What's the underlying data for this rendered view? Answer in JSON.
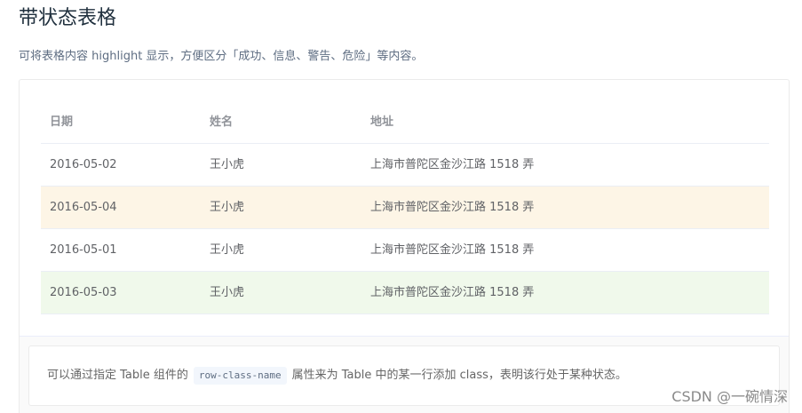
{
  "page": {
    "title": "带状态表格",
    "description": "可将表格内容 highlight 显示，方便区分「成功、信息、警告、危险」等内容。"
  },
  "table": {
    "headers": [
      "日期",
      "姓名",
      "地址"
    ],
    "rows": [
      {
        "date": "2016-05-02",
        "name": "王小虎",
        "address": "上海市普陀区金沙江路 1518 弄",
        "status": "normal"
      },
      {
        "date": "2016-05-04",
        "name": "王小虎",
        "address": "上海市普陀区金沙江路 1518 弄",
        "status": "warning"
      },
      {
        "date": "2016-05-01",
        "name": "王小虎",
        "address": "上海市普陀区金沙江路 1518 弄",
        "status": "normal"
      },
      {
        "date": "2016-05-03",
        "name": "王小虎",
        "address": "上海市普陀区金沙江路 1518 弄",
        "status": "success"
      }
    ]
  },
  "meta": {
    "text_before": "可以通过指定 Table 组件的",
    "code": "row-class-name",
    "text_after": "属性来为 Table 中的某一行添加 class，表明该行处于某种状态。"
  },
  "watermark": "CSDN @一碗情深",
  "colors": {
    "warning_row": "#fdf5e6",
    "success_row": "#f0f9eb",
    "header_text": "#909399",
    "body_text": "#606266"
  }
}
